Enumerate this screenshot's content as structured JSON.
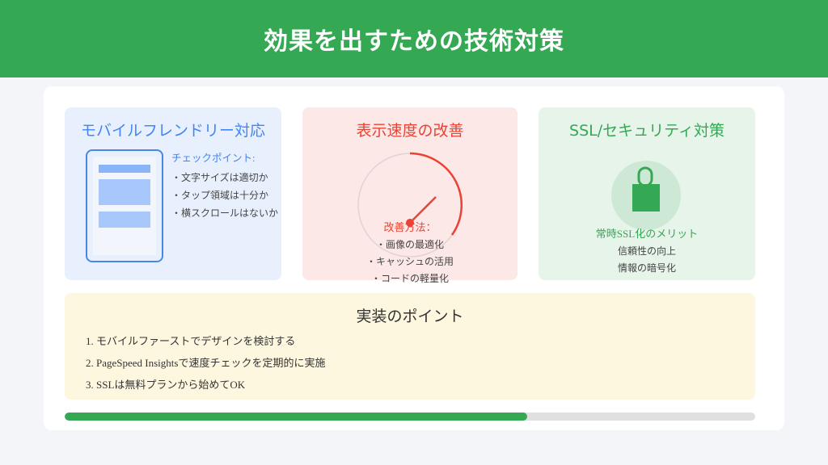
{
  "header": {
    "title": "効果を出すための技術対策"
  },
  "cards": {
    "mobile": {
      "title": "モバイルフレンドリー対応",
      "icon": "smartphone-icon",
      "checklist_heading": "チェックポイント:",
      "checklist": [
        "・文字サイズは適切か",
        "・タップ領域は十分か",
        "・横スクロールはないか"
      ]
    },
    "speed": {
      "title": "表示速度の改善",
      "icon": "speedometer-icon",
      "methods_heading": "改善方法：",
      "methods": [
        "・画像の最適化",
        "・キャッシュの活用",
        "・コードの軽量化"
      ]
    },
    "ssl": {
      "title": "SSL/セキュリティ対策",
      "icon": "lock-icon",
      "merits_heading": "常時SSL化のメリット",
      "merits": [
        "信頼性の向上",
        "情報の暗号化"
      ]
    }
  },
  "points": {
    "title": "実装のポイント",
    "items": [
      "1. モバイルファーストでデザインを検討する",
      "2. PageSpeed Insightsで速度チェックを定期的に実施",
      "3. SSLは無料プランから始めてOK"
    ]
  },
  "progress": {
    "fraction": 0.67
  },
  "colors": {
    "header": "#34a853",
    "blue": "#4285f4",
    "red": "#ea4335",
    "green": "#34a853",
    "track": "#e0e0e0"
  }
}
